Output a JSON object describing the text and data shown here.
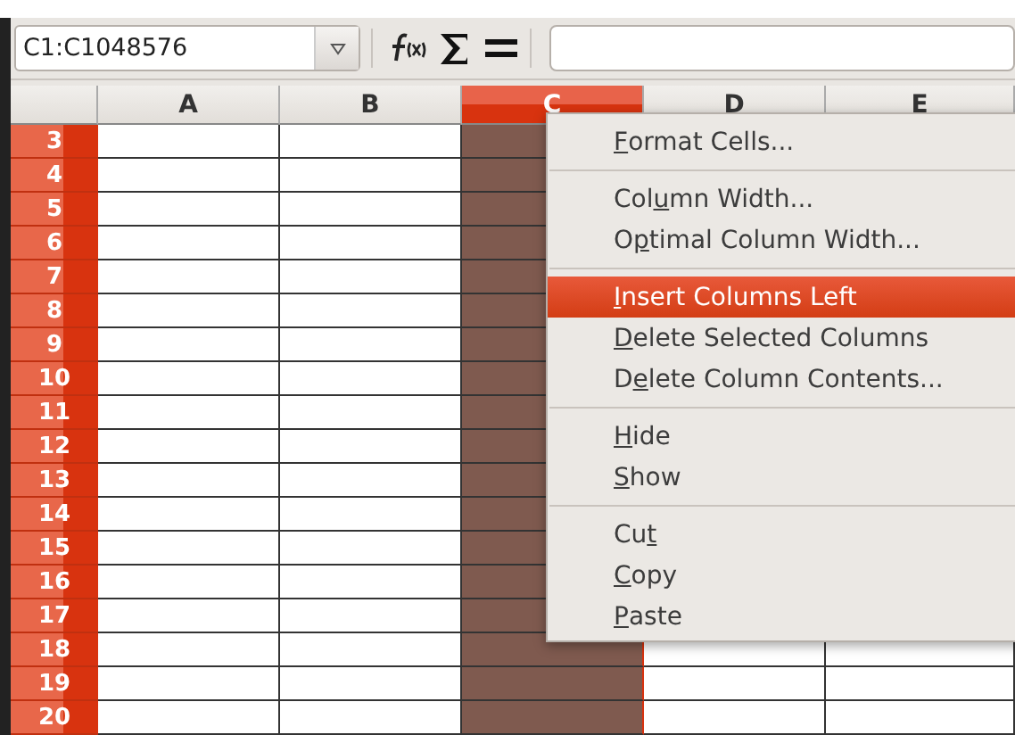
{
  "toolbar": {
    "name_box": "C1:C1048576"
  },
  "columns": [
    {
      "label": "A",
      "selected": false
    },
    {
      "label": "B",
      "selected": false
    },
    {
      "label": "C",
      "selected": true
    },
    {
      "label": "D",
      "selected": false
    },
    {
      "label": "E",
      "selected": false
    }
  ],
  "rows": [
    "3",
    "4",
    "5",
    "6",
    "7",
    "8",
    "9",
    "10",
    "11",
    "12",
    "13",
    "14",
    "15",
    "16",
    "17",
    "18",
    "19",
    "20"
  ],
  "context_menu": [
    {
      "kind": "item",
      "key": "F",
      "post": "ormat Cells...",
      "selected": false
    },
    {
      "kind": "separator"
    },
    {
      "kind": "item",
      "pre": "Col",
      "key": "u",
      "post": "mn Width...",
      "selected": false
    },
    {
      "kind": "item",
      "pre": "O",
      "key": "p",
      "post": "timal Column Width...",
      "selected": false
    },
    {
      "kind": "separator"
    },
    {
      "kind": "item",
      "key": "I",
      "post": "nsert Columns Left",
      "selected": true
    },
    {
      "kind": "item",
      "key": "D",
      "post": "elete Selected Columns",
      "selected": false
    },
    {
      "kind": "item",
      "pre": "D",
      "key": "e",
      "post": "lete Column Contents...",
      "selected": false
    },
    {
      "kind": "separator"
    },
    {
      "kind": "item",
      "key": "H",
      "post": "ide",
      "selected": false
    },
    {
      "kind": "item",
      "key": "S",
      "post": "how",
      "selected": false
    },
    {
      "kind": "separator"
    },
    {
      "kind": "item",
      "pre": "Cu",
      "key": "t",
      "selected": false
    },
    {
      "kind": "item",
      "key": "C",
      "post": "opy",
      "selected": false
    },
    {
      "kind": "item",
      "key": "P",
      "post": "aste",
      "selected": false
    }
  ]
}
